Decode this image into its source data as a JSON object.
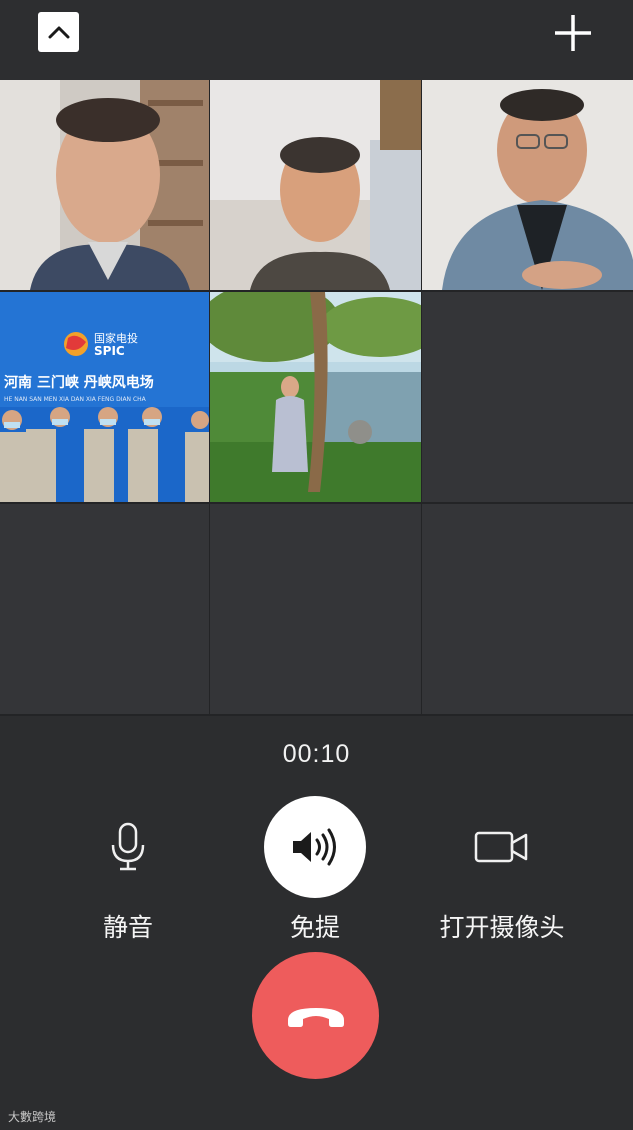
{
  "topbar": {
    "collapse_icon": "chevron-up-icon",
    "add_icon": "plus-icon"
  },
  "participants": [
    {
      "name": "participant-1",
      "type": "video"
    },
    {
      "name": "participant-2",
      "type": "video"
    },
    {
      "name": "participant-3",
      "type": "video"
    },
    {
      "name": "participant-4",
      "type": "video",
      "banner_cn": "国家电投",
      "banner_en": "SPIC",
      "banner_title": "河南 三门峡 丹峡风电场",
      "banner_pinyin": "HE NAN SAN MEN XIA DAN XIA FENG DIAN CHA"
    },
    {
      "name": "participant-5",
      "type": "video"
    }
  ],
  "call": {
    "timer": "00:10",
    "mute_label": "静音",
    "speaker_label": "免提",
    "camera_label": "打开摄像头",
    "speaker_on": true
  },
  "watermark": "大數跨境",
  "colors": {
    "background": "#2b2c2e",
    "hangup": "#ee5c5c",
    "button_active": "#ffffff"
  }
}
